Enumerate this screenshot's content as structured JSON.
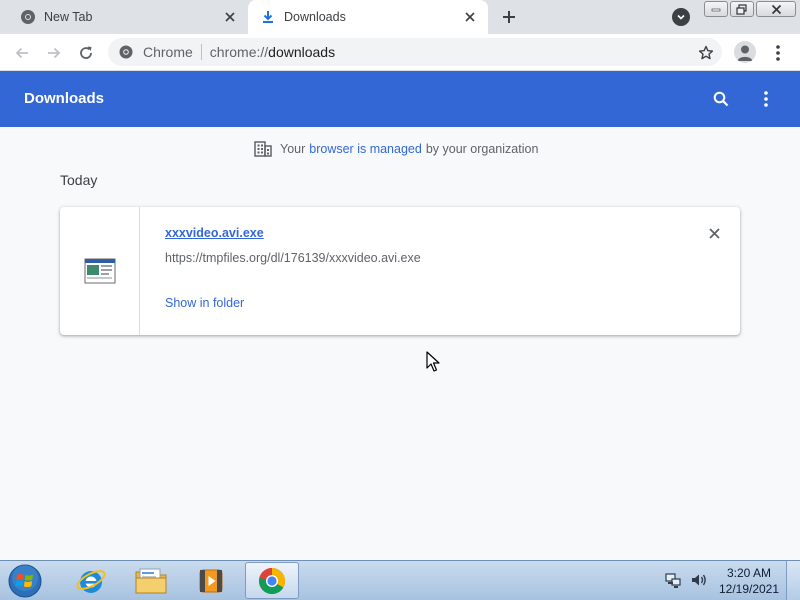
{
  "tabs": [
    {
      "title": "New Tab",
      "favicon": "chrome-icon"
    },
    {
      "title": "Downloads",
      "favicon": "download-icon"
    }
  ],
  "omnibox": {
    "scheme_label": "Chrome",
    "url_scheme": "chrome://",
    "url_host": "downloads"
  },
  "header": {
    "title": "Downloads"
  },
  "managed_notice": {
    "prefix": "Your",
    "link": "browser is managed",
    "suffix": "by your organization"
  },
  "section": {
    "label": "Today"
  },
  "download": {
    "filename": "xxxvideo.avi.exe",
    "url": "https://tmpfiles.org/dl/176139/xxxvideo.avi.exe",
    "action": "Show in folder"
  },
  "taskbar": {
    "items": [
      "internet-explorer-icon",
      "file-explorer-icon",
      "media-player-icon",
      "chrome-icon"
    ],
    "time": "3:20 AM",
    "date": "12/19/2021"
  },
  "colors": {
    "accent": "#3367d6",
    "header_bg": "#3367d6",
    "page_bg": "#f8f9fa",
    "tabstrip_bg": "#dee1e6"
  }
}
